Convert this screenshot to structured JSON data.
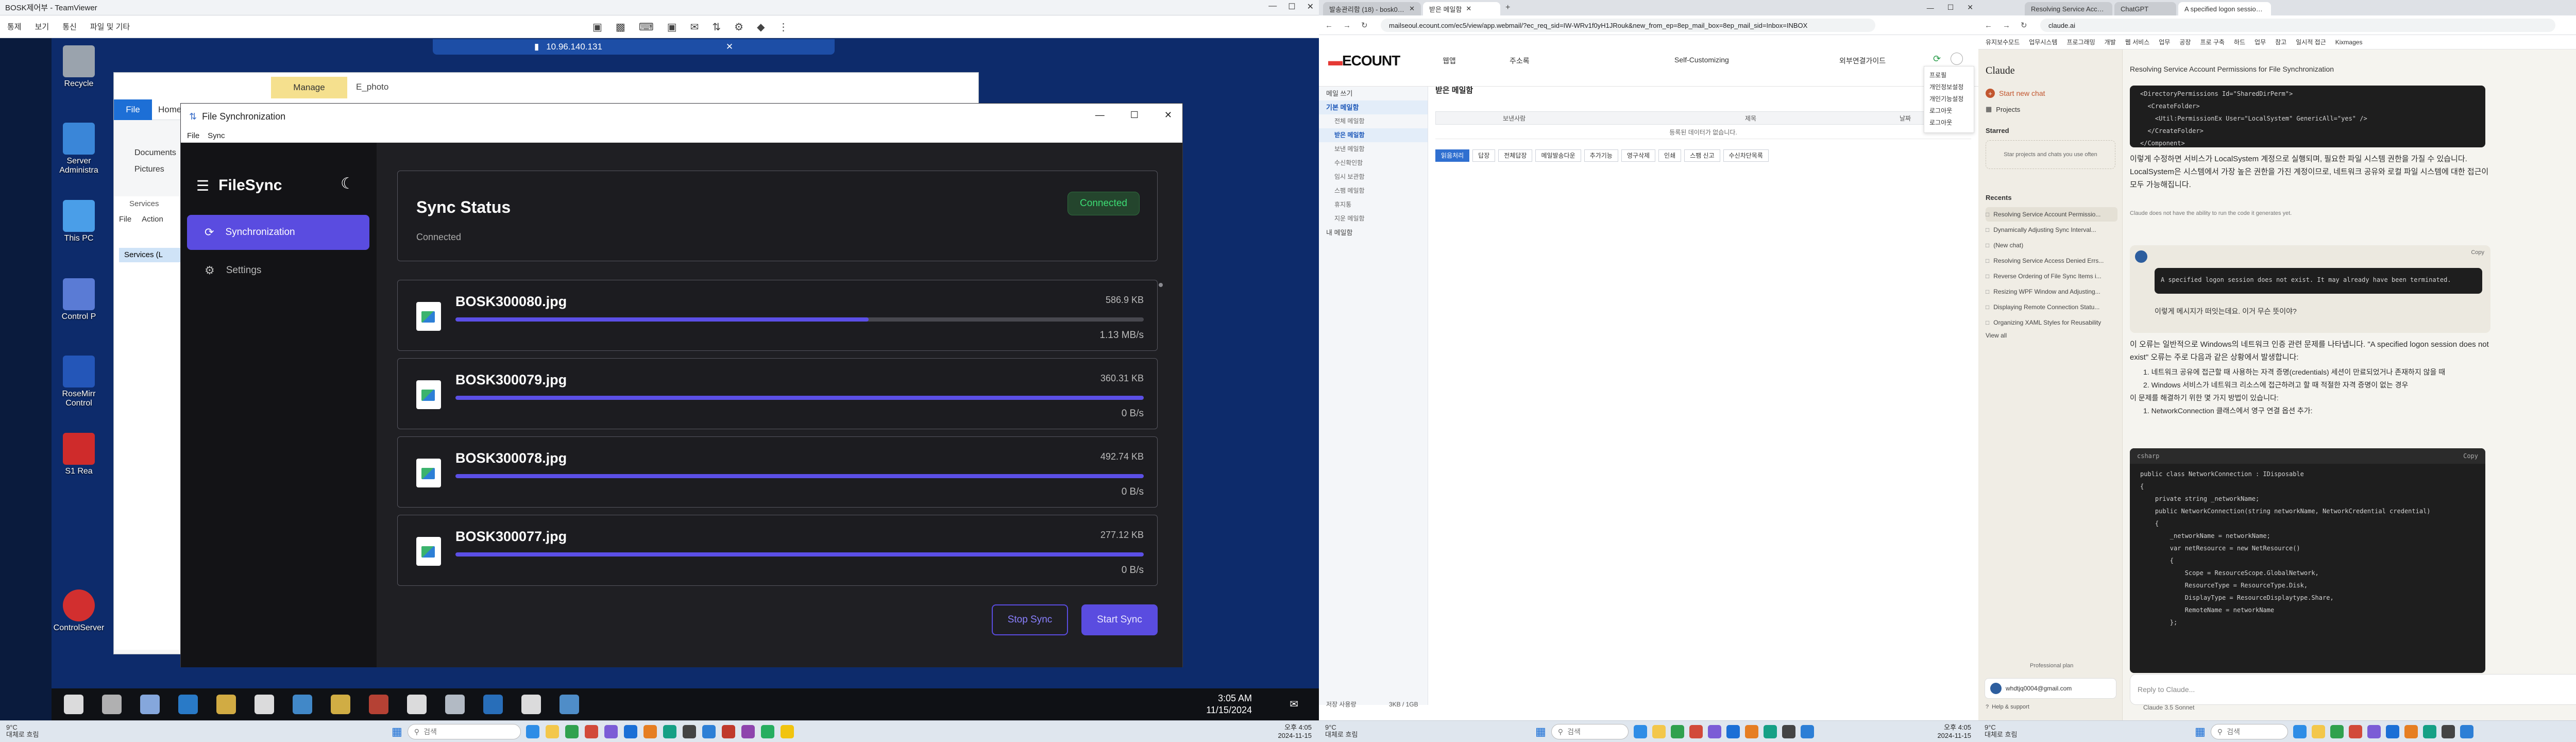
{
  "monitor1": {
    "teamviewer": {
      "title": "BOSK제어부 - TeamViewer",
      "menu": [
        "통제",
        "보기",
        "통신",
        "파일 및 기타"
      ],
      "remote_id": "10.96.140.131"
    },
    "desktop_icons": [
      {
        "label": "Recycle",
        "color": "#9aa3ad"
      },
      {
        "label": "Server\nAdministra",
        "color": "#3a86d8"
      },
      {
        "label": "This PC",
        "color": "#4a9ee8"
      },
      {
        "label": "Control P",
        "color": "#5a7bd5"
      },
      {
        "label": "RoseMirr\nControl",
        "color": "#2456b8"
      },
      {
        "label": "S1 Rea",
        "color": "#cf2b2b"
      },
      {
        "label": "ControlServer",
        "color": "#d22f2f"
      }
    ],
    "explorer": {
      "manage_tab": "Manage",
      "path_title": "E_photo",
      "tabs": [
        "File",
        "Home"
      ],
      "quick_items": [
        "Documents",
        "Pictures"
      ],
      "services_header": "Services",
      "services_menu": [
        "File",
        "Action"
      ],
      "services_item": "Services (L"
    },
    "filesync": {
      "window_title": "File Synchronization",
      "menu": [
        "File",
        "Sync"
      ],
      "brand": "FileSync",
      "nav": [
        {
          "label": "Synchronization",
          "active": true
        },
        {
          "label": "Settings",
          "active": false
        }
      ],
      "status": {
        "title": "Sync Status",
        "subtitle": "Connected",
        "badge": "Connected"
      },
      "files": [
        {
          "name": "BOSK300080.jpg",
          "size": "586.9 KB",
          "progress": 0.6,
          "rate": "1.13 MB/s"
        },
        {
          "name": "BOSK300079.jpg",
          "size": "360.31 KB",
          "progress": 1.0,
          "rate": "0 B/s"
        },
        {
          "name": "BOSK300078.jpg",
          "size": "492.74 KB",
          "progress": 1.0,
          "rate": "0 B/s"
        },
        {
          "name": "BOSK300077.jpg",
          "size": "277.12 KB",
          "progress": 1.0,
          "rate": "0 B/s"
        }
      ],
      "stop_label": "Stop Sync",
      "start_label": "Start Sync"
    },
    "remote_taskbar": {
      "time": "3:05 AM",
      "date": "11/15/2024",
      "icon_colors": [
        "#ffffff",
        "#cccccc",
        "#9ac2ff",
        "#2e8de6",
        "#f3c74b",
        "#ffffff",
        "#4a9ee8",
        "#f2c94c",
        "#d24a3a",
        "#ffffff",
        "#cfd8e3",
        "#2d7fd6",
        "#ffffff",
        "#5aa3e8"
      ]
    },
    "host_taskbar": {
      "weather_temp": "9°C",
      "weather_desc": "대체로 흐림",
      "search": "검색",
      "time": "오후 4:05",
      "date": "2024-11-15"
    }
  },
  "monitor2": {
    "tabs": [
      {
        "label": "발송관리함 (18) - bosk0708@...",
        "active": false
      },
      {
        "label": "받은 메일함",
        "active": true
      }
    ],
    "url": "mailseoul.ecount.com/ec5/view/app.webmail/?ec_req_sid=IW-WRv1f0yH1JRouk&new_from_ep=8ep_mail_box=8ep_mail_sid=Inbox=INBOX",
    "logo_brand": "ECOUNT",
    "nav": [
      "웹앱",
      "주소록",
      "Self-Customizing",
      "외부연결가이드"
    ],
    "header_right": "로그아웃",
    "sidebar": {
      "top": "메일 쓰기",
      "section": "기본 메일함",
      "items": [
        "받은 메일함",
        "전체 메일함",
        "받은 메일함",
        "보낸 메일함",
        "수신확인함",
        "임시 보관함",
        "스팸 메일함",
        "휴지통",
        "지운 메일함"
      ],
      "more": "내 메일함"
    },
    "page_title": "받은 메일함",
    "table_headers": [
      "보낸사람",
      "제목",
      "날짜"
    ],
    "empty_text": "등록된 데이터가 없습니다.",
    "toolbar": [
      "읽음처리",
      "답장",
      "전체답장",
      "메일발송다운",
      "추가기능",
      "영구삭제",
      "인쇄",
      "스팸 신고",
      "수신차단목록"
    ],
    "dropdown": [
      "프로필",
      "개인정보설정",
      "개인기능설정",
      "로그아웃",
      "로그아웃"
    ],
    "storage": "저장 사용량",
    "storage_value": "3KB / 1GB"
  },
  "monitor3": {
    "tabs": [
      {
        "label": "Resolving Service Account Pe...",
        "active": false
      },
      {
        "label": "ChatGPT",
        "active": false
      },
      {
        "label": "A specified logon session does...",
        "active": true
      }
    ],
    "url": "claude.ai",
    "bookmarks": [
      "유지보수모드",
      "업무시스템",
      "프로그래밍",
      "개발",
      "웹 서비스",
      "업무",
      "공장",
      "프로 구축",
      "하드",
      "업무",
      "참고",
      "일시적 접근",
      "Kixmages"
    ],
    "brand": "Claude",
    "new_chat": "Start new chat",
    "projects": "Projects",
    "starred": "Starred",
    "starred_hint": "Star projects and chats you use often",
    "recents_label": "Recents",
    "recents": [
      "Resolving Service Account Permissio...",
      "Dynamically Adjusting Sync Interval...",
      "(New chat)",
      "Resolving Service Access Denied Errs...",
      "Reverse Ordering of File Sync Items i...",
      "Resizing WPF Window and Adjusting...",
      "Displaying Remote Connection Statu...",
      "Organizing XAML Styles for Reusability"
    ],
    "view_all": "View all",
    "plan": "Professional plan",
    "user_email": "whdtjq0004@gmail.com",
    "chat_title": "Resolving Service Account Permissions for File Synchronization",
    "code1_lines": [
      "<DirectoryPermissions Id=\"SharedDirPerm\">",
      "  <CreateFolder>",
      "    <Util:PermissionEx User=\"LocalSystem\" GenericAll=\"yes\" />",
      "  </CreateFolder>",
      "</Component>"
    ],
    "para1": "이렇게 수정하면 서비스가 LocalSystem 계정으로 실행되며, 필요한 파일 시스템 권한을 가질 수 있습니다. LocalSystem은 시스템에서 가장 높은 권한을 가진 계정이므로, 네트워크 공유와 로컬 파일 시스템에 대한 접근이 모두 가능해집니다.",
    "disclaimer": "Claude does not have the ability to run the code it generates yet.",
    "user_msg_code": "A specified logon session does not exist. It may already have been terminated.",
    "user_msg_text": "이렇게 메시지가 떠잇는데요. 이거 무슨 뜻이야?",
    "para2": "이 오류는 일반적으로 Windows의 네트워크 인증 관련 문제를 나타냅니다. \"A specified logon session does not exist\" 오류는 주로 다음과 같은 상황에서 발생합니다:",
    "list": [
      "네트워크 공유에 접근할 때 사용하는 자격 증명(credentials) 세션이 만료되었거나 존재하지 않을 때",
      "Windows 서비스가 네트워크 리소스에 접근하려고 할 때 적절한 자격 증명이 없는 경우",
      "이 문제를 해결하기 위한 몇 가지 방법이 있습니다:",
      "NetworkConnection 클래스에서 영구 연결 옵션 추가:"
    ],
    "code2_lang": "csharp",
    "code2_lines": [
      "public class NetworkConnection : IDisposable",
      "{",
      "    private string _networkName;",
      "",
      "    public NetworkConnection(string networkName, NetworkCredential credential)",
      "    {",
      "        _networkName = networkName;",
      "",
      "        var netResource = new NetResource()",
      "        {",
      "            Scope = ResourceScope.GlobalNetwork,",
      "            ResourceType = ResourceType.Disk,",
      "            DisplayType = ResourceDisplaytype.Share,",
      "            RemoteName = networkName",
      "        };"
    ],
    "copy_label": "Copy",
    "input_placeholder": "Reply to Claude...",
    "model": "Claude 3.5 Sonnet",
    "help": "Help & support"
  }
}
